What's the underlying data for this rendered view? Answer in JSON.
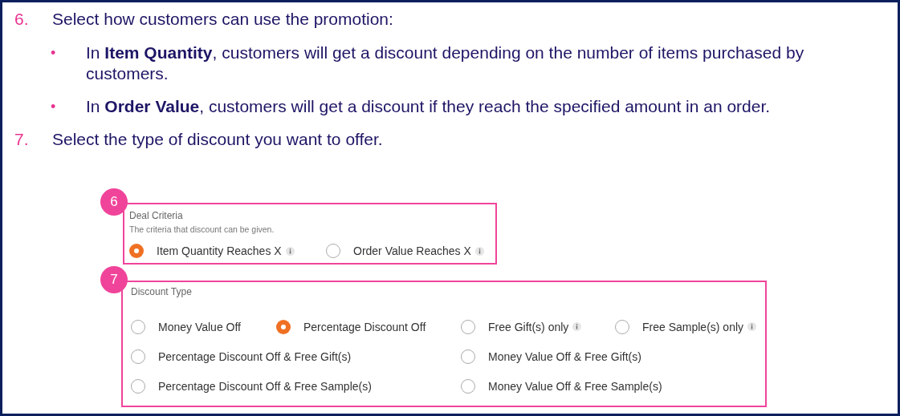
{
  "steps": [
    {
      "number": "6.",
      "text": "Select how customers can use the promotion:",
      "bullets": [
        {
          "marker": "•",
          "text": "In **Item Quantity**, customers will get a discount depending on the number of items purchased by customers."
        },
        {
          "marker": "•",
          "text": "In **Order Value**, customers will get a discount if they reach the specified amount in an order."
        }
      ]
    },
    {
      "number": "7.",
      "text": "Select the type of discount you want to offer."
    }
  ],
  "deal_criteria": {
    "badge": "6",
    "title": "Deal Criteria",
    "subtitle": "The criteria that discount can be given.",
    "rows": [
      [
        {
          "label": "Item Quantity Reaches X",
          "selected": true,
          "info": true
        },
        {
          "label": "Order Value Reaches X",
          "selected": false,
          "info": true
        }
      ]
    ]
  },
  "discount_type": {
    "badge": "7",
    "title": "Discount Type",
    "rows": [
      [
        {
          "label": "Money Value Off",
          "selected": false,
          "info": false
        },
        {
          "label": "Percentage Discount Off",
          "selected": true,
          "info": false
        },
        {
          "label": "Free Gift(s) only",
          "selected": false,
          "info": true
        },
        {
          "label": "Free Sample(s) only",
          "selected": false,
          "info": true
        }
      ],
      [
        {
          "label": "Percentage Discount Off & Free Gift(s)",
          "selected": false,
          "info": false
        },
        {
          "label": "Money Value Off & Free Gift(s)",
          "selected": false,
          "info": false
        }
      ],
      [
        {
          "label": "Percentage Discount Off & Free Sample(s)",
          "selected": false,
          "info": false
        },
        {
          "label": "Money Value Off & Free Sample(s)",
          "selected": false,
          "info": false
        }
      ]
    ]
  }
}
